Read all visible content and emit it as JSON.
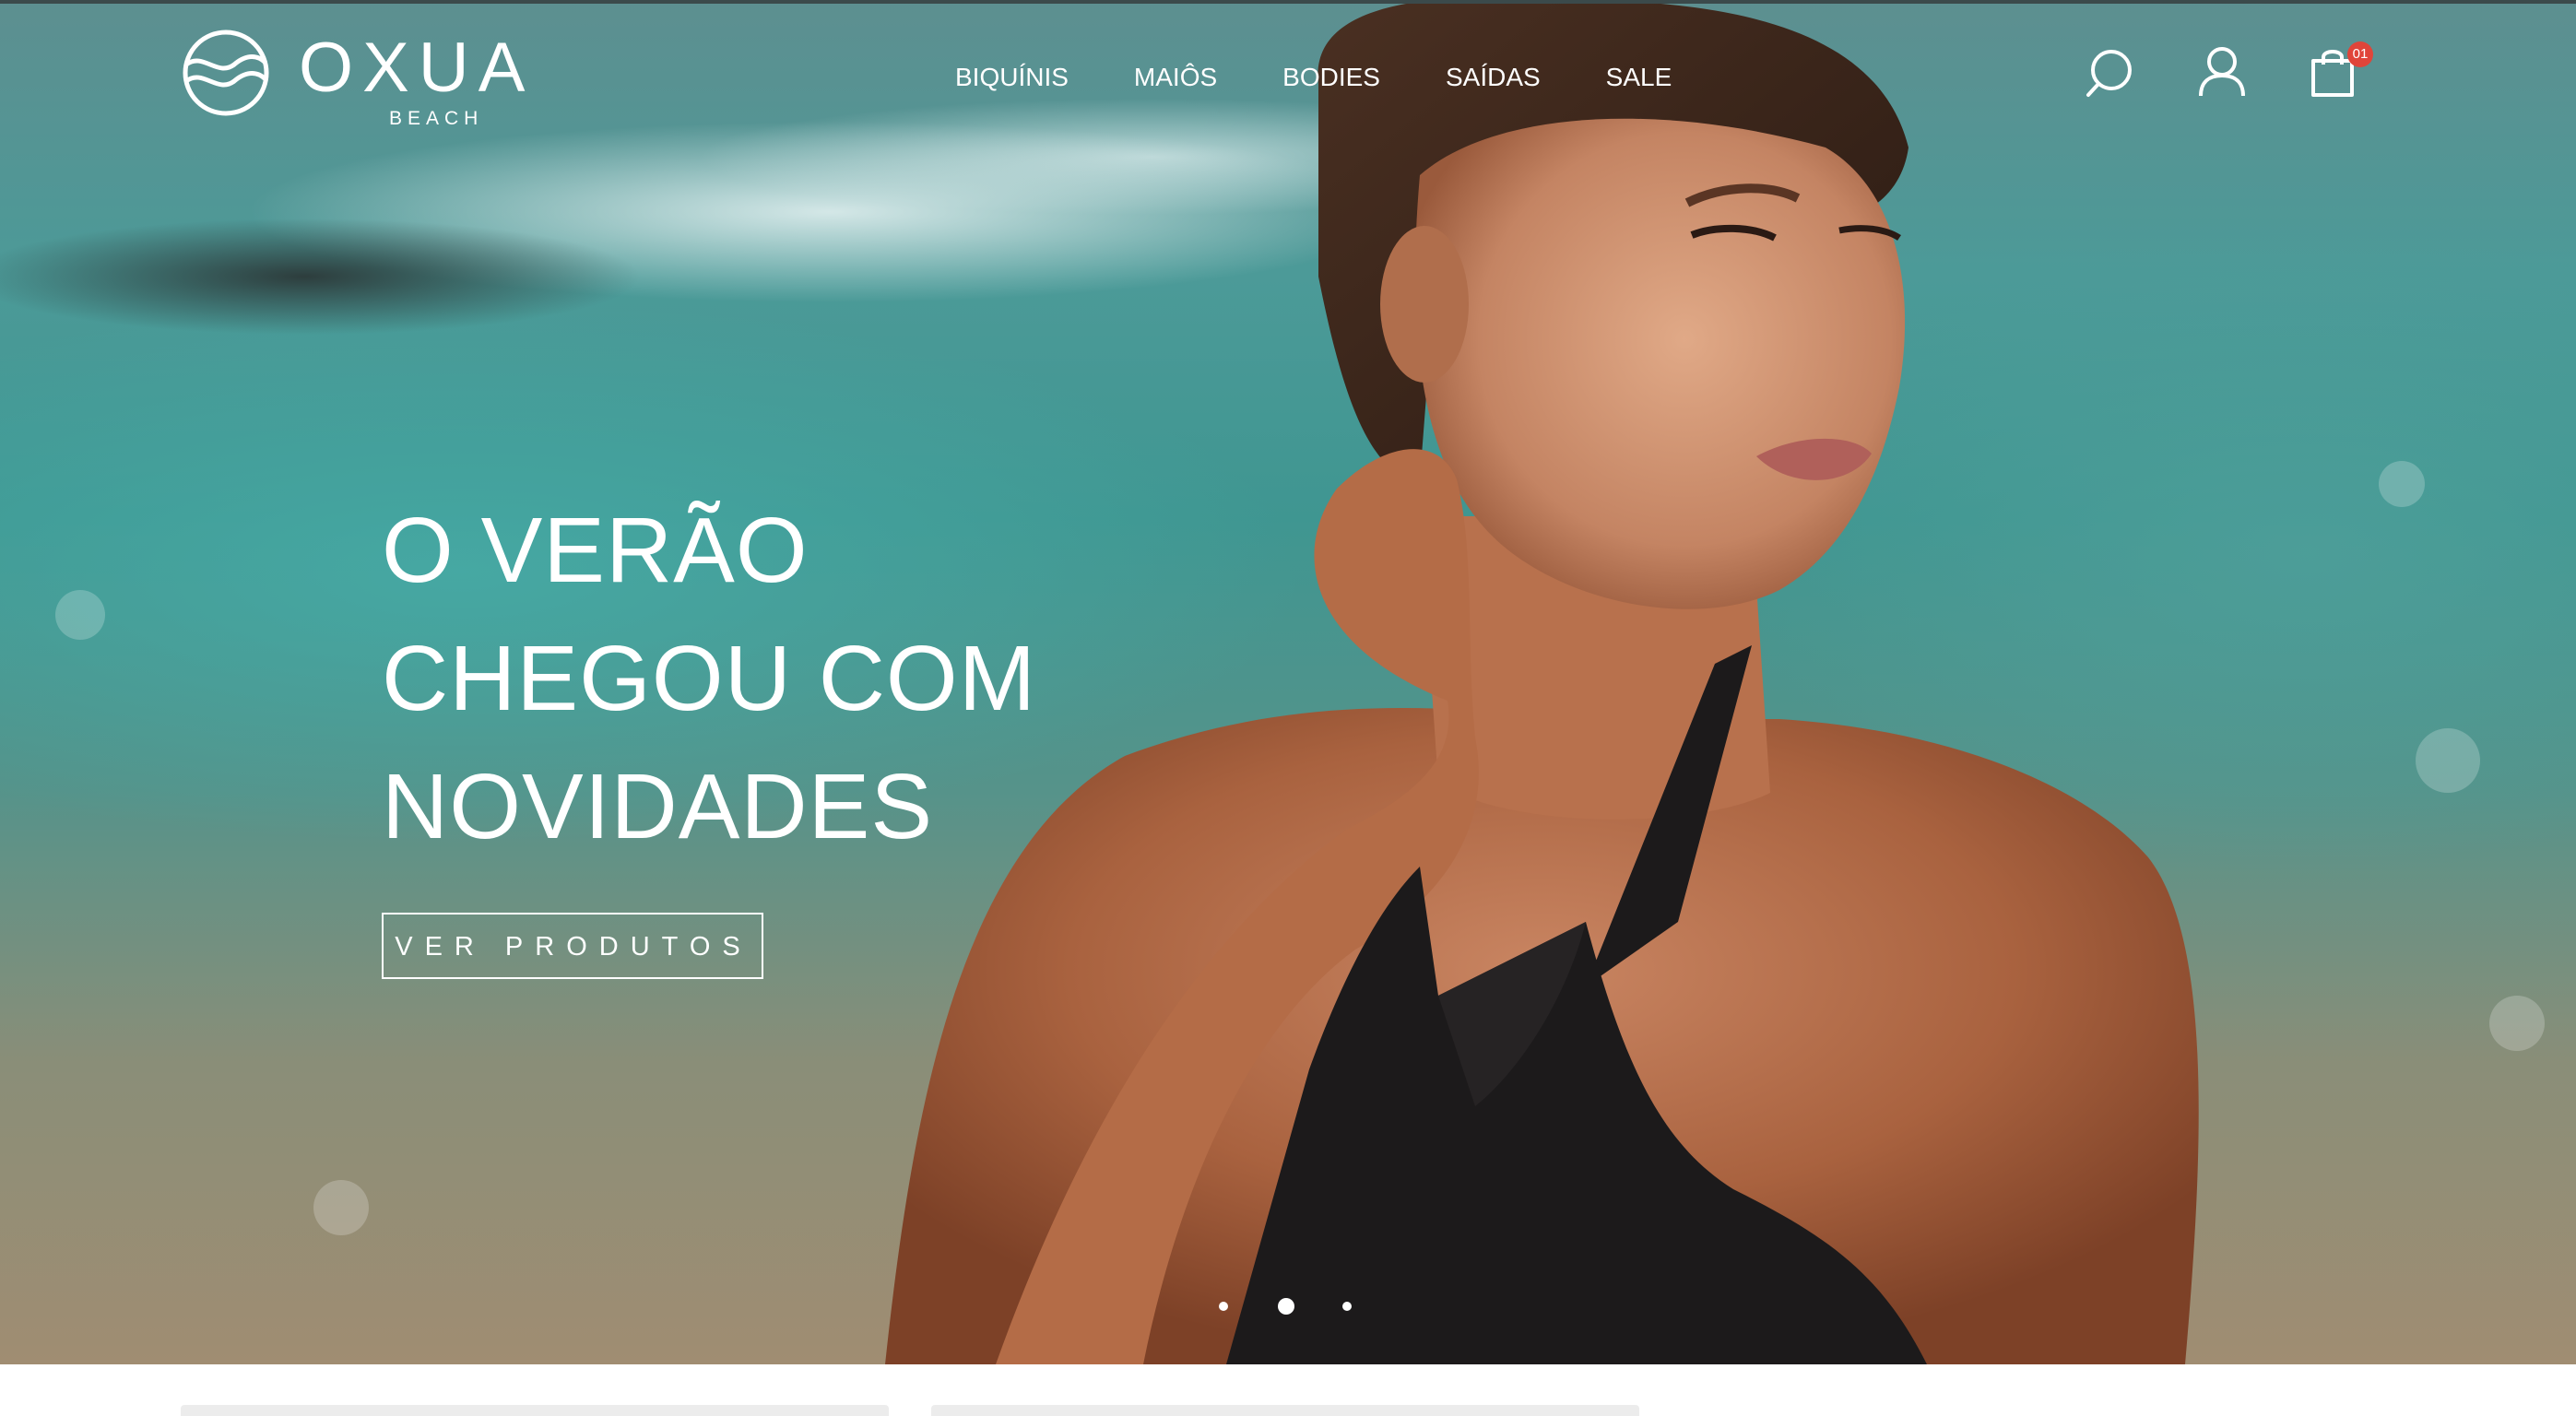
{
  "brand": {
    "name": "OXUA",
    "sub": "BEACH"
  },
  "nav": {
    "items": [
      {
        "label": "BIQUÍNIS"
      },
      {
        "label": "MAIÔS"
      },
      {
        "label": "BODIES"
      },
      {
        "label": "SAÍDAS"
      },
      {
        "label": "SALE"
      }
    ]
  },
  "header": {
    "icons": [
      "search-icon",
      "user-icon",
      "shopping-bag-icon"
    ],
    "cart_count": "01"
  },
  "hero": {
    "headline_lines": [
      "O VERÃO",
      "CHEGOU COM",
      "NOVIDADES"
    ],
    "cta_label": "VER PRODUTOS",
    "slides": {
      "total": 3,
      "active": 2
    }
  },
  "colors": {
    "badge": "#e0453a",
    "text_on_hero": "#ffffff",
    "swimsuit": "#1c1a1b"
  }
}
